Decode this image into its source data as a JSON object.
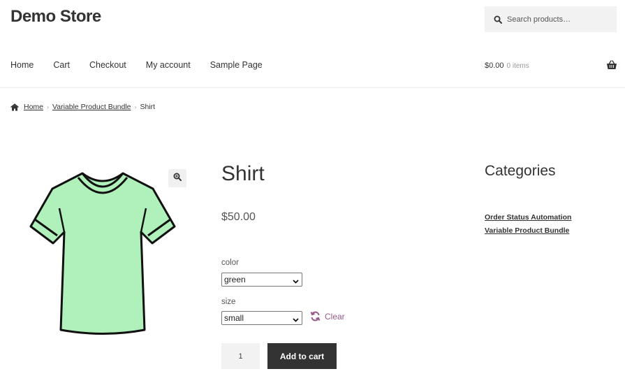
{
  "site": {
    "title": "Demo Store"
  },
  "search": {
    "placeholder": "Search products…"
  },
  "nav": {
    "items": [
      "Home",
      "Cart",
      "Checkout",
      "My account",
      "Sample Page"
    ]
  },
  "cart": {
    "total": "$0.00",
    "count": "0 items"
  },
  "breadcrumb": {
    "home": "Home",
    "sep": "›",
    "category": "Variable Product Bundle",
    "current": "Shirt"
  },
  "product": {
    "title": "Shirt",
    "price": "$50.00",
    "color_label": "color",
    "color_value": "green",
    "size_label": "size",
    "size_value": "small",
    "clear_label": "Clear",
    "quantity": "1",
    "add_to_cart": "Add to cart",
    "image_color": "#b0f0bb"
  },
  "sidebar": {
    "title": "Categories",
    "items": [
      "Order Status Automation",
      "Variable Product Bundle"
    ]
  },
  "colors": {
    "accent": "#96588a",
    "button": "#333333"
  }
}
